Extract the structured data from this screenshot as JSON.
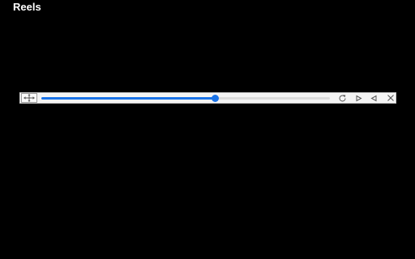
{
  "app": {
    "title": "Reels"
  },
  "player": {
    "progress_percent": 60,
    "accent_color": "#1a73e8",
    "icons": {
      "drag": "move-arrows-icon",
      "reload": "reload-icon",
      "forward": "play-forward-icon",
      "back": "play-back-icon",
      "close": "close-icon"
    }
  }
}
